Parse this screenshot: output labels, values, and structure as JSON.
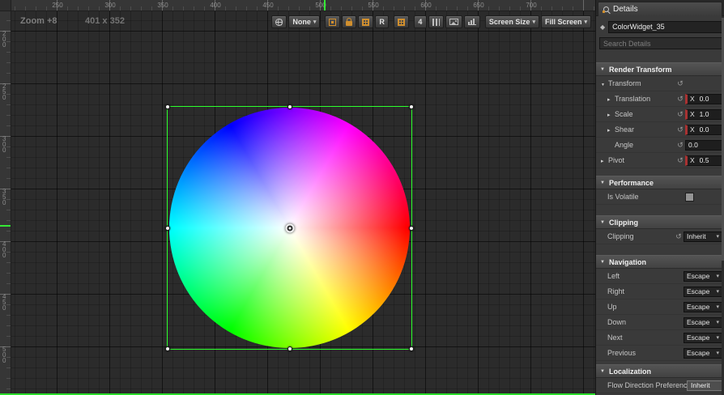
{
  "canvas": {
    "zoom_label": "Zoom +8",
    "size_label": "401 x 352",
    "ruler_top": [
      "250",
      "300",
      "350",
      "400",
      "450",
      "500",
      "550",
      "600",
      "650",
      "700"
    ],
    "ruler_left": [
      "200",
      "250",
      "300",
      "350",
      "400",
      "450",
      "500"
    ],
    "toolbar": {
      "preview_none": "None",
      "r_button": "R",
      "grid_snap": "4",
      "screen_size": "Screen Size",
      "fill_screen": "Fill Screen"
    }
  },
  "details": {
    "tab": "Details",
    "widget_name": "ColorWidget_35",
    "search_placeholder": "Search Details",
    "render_transform": {
      "header": "Render Transform",
      "transform_label": "Transform",
      "rows": [
        {
          "label": "Translation",
          "axis": "X",
          "value": "0.0"
        },
        {
          "label": "Scale",
          "axis": "X",
          "value": "1.0"
        },
        {
          "label": "Shear",
          "axis": "X",
          "value": "0.0"
        },
        {
          "label": "Angle",
          "axis": "",
          "value": "0.0"
        }
      ],
      "pivot_label": "Pivot",
      "pivot_axis": "X",
      "pivot_value": "0.5"
    },
    "performance": {
      "header": "Performance",
      "is_volatile_label": "Is Volatile"
    },
    "clipping": {
      "header": "Clipping",
      "label": "Clipping",
      "value": "Inherit"
    },
    "navigation": {
      "header": "Navigation",
      "rows": [
        {
          "label": "Left",
          "value": "Escape"
        },
        {
          "label": "Right",
          "value": "Escape"
        },
        {
          "label": "Up",
          "value": "Escape"
        },
        {
          "label": "Down",
          "value": "Escape"
        },
        {
          "label": "Next",
          "value": "Escape"
        },
        {
          "label": "Previous",
          "value": "Escape"
        }
      ]
    },
    "localization": {
      "header": "Localization",
      "label": "Flow Direction Preference",
      "value": "Inherit"
    }
  },
  "icons": {
    "toolbar": [
      "globe-icon",
      "anchor-icon",
      "lock-icon",
      "grid-orange-icon",
      "columns-icon",
      "image-icon",
      "stats-icon"
    ],
    "details": [
      "magnifier-icon",
      "diamond-icon",
      "reset-icon",
      "expander-icon",
      "checkbox"
    ]
  },
  "colors": {
    "selection_green": "#2bff2b",
    "accent_orange": "#d08f2e",
    "canvas_background": "#2b2b2b",
    "panel_background": "#3a3a3a",
    "axis_x_red": "#a83232"
  }
}
